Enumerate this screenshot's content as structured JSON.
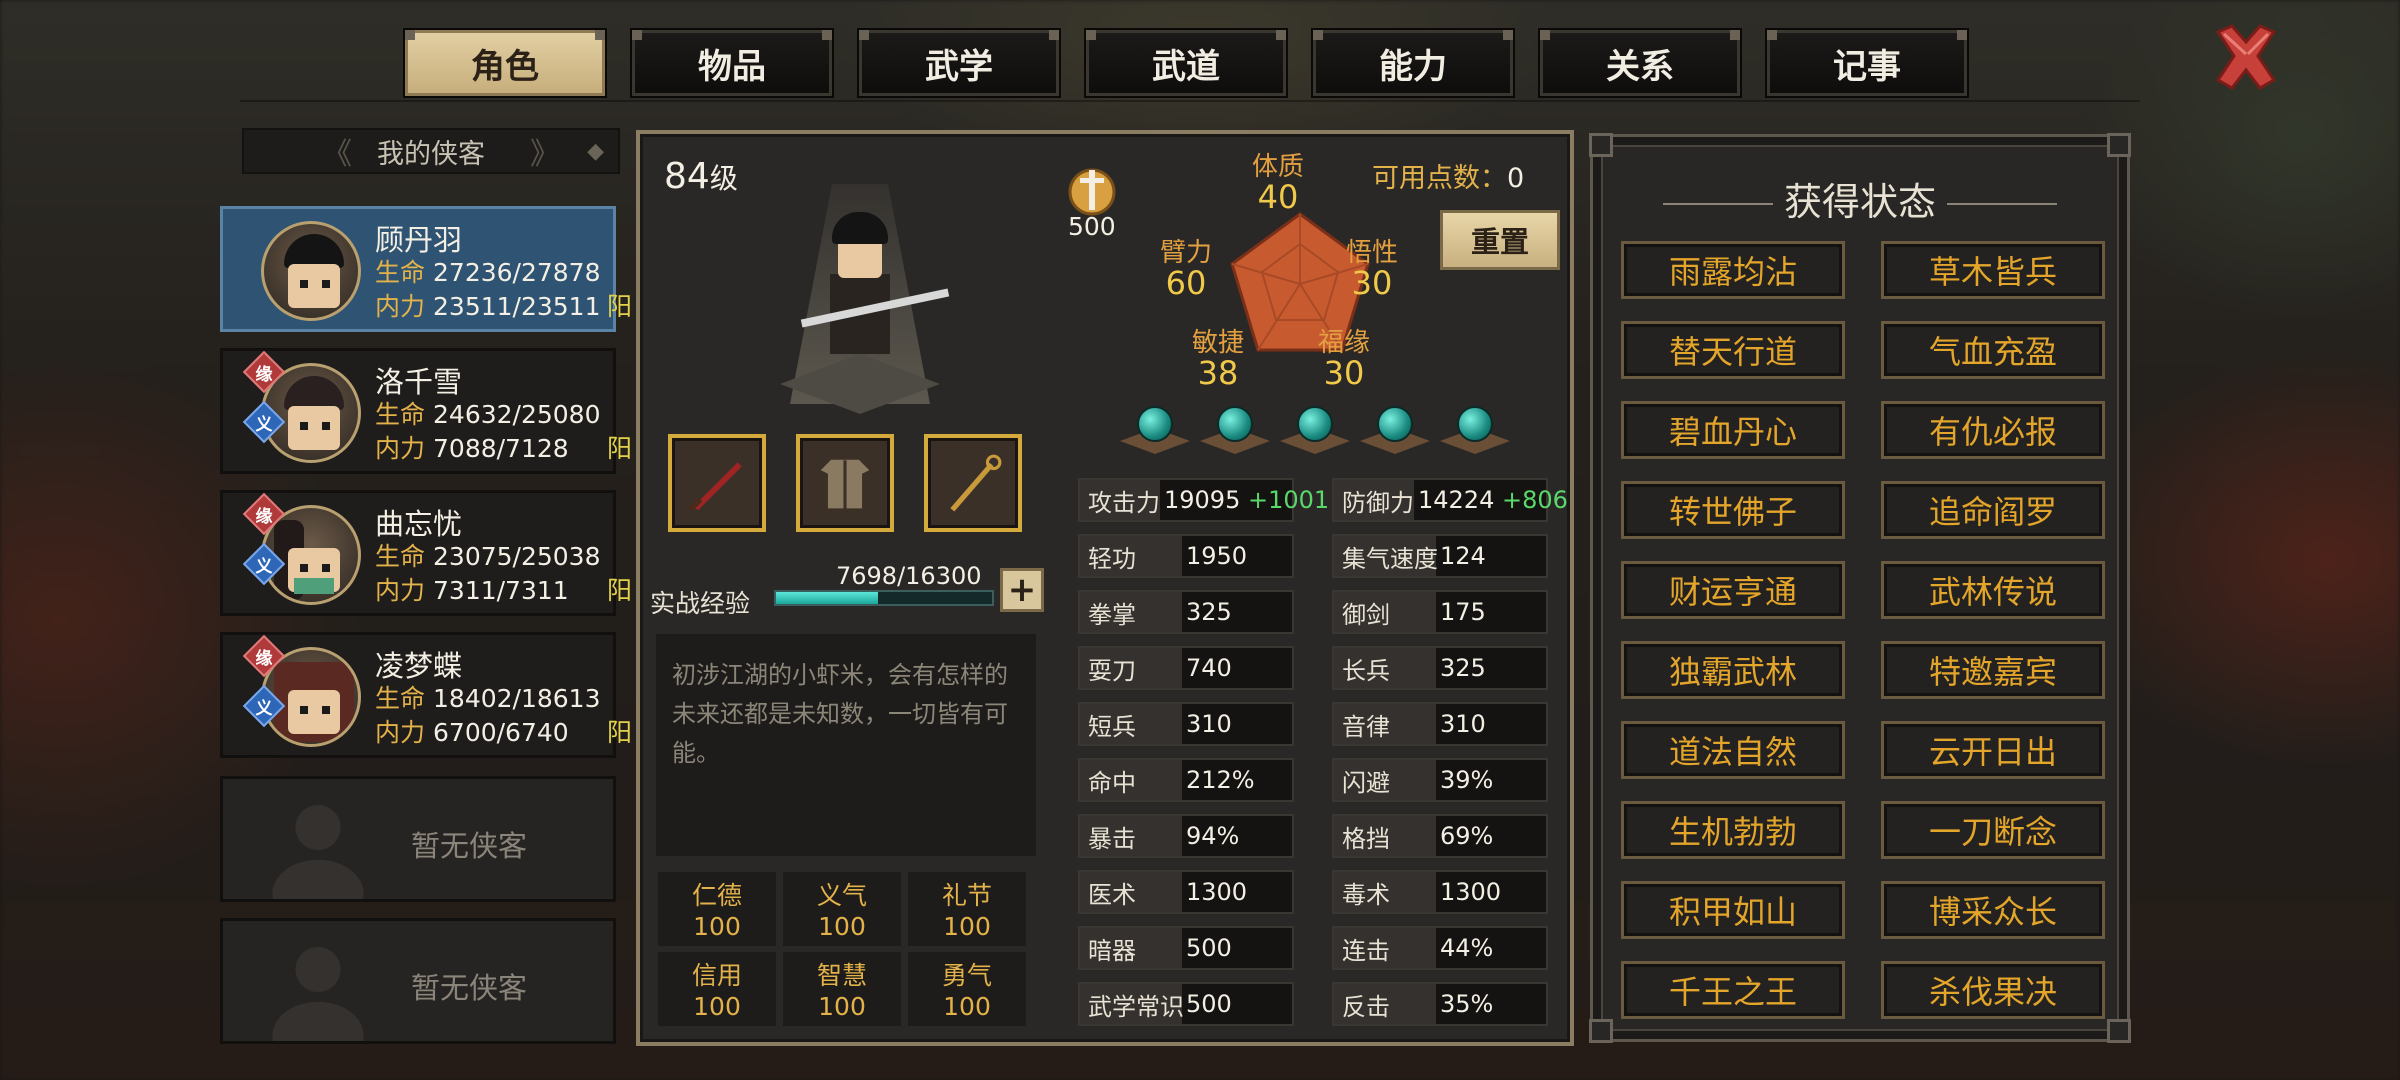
{
  "tabs": [
    "角色",
    "物品",
    "武学",
    "武道",
    "能力",
    "关系",
    "记事"
  ],
  "active_tab": 0,
  "list_header": "我的侠客",
  "characters": [
    {
      "name": "顾丹羽",
      "hp_label": "生命",
      "hp": "27236/27878",
      "mp_label": "内力",
      "mp": "23511/23511",
      "yang": "阳"
    },
    {
      "name": "洛千雪",
      "hp_label": "生命",
      "hp": "24632/25080",
      "mp_label": "内力",
      "mp": "7088/7128",
      "yang": "阳",
      "badge_yuan": "缘",
      "badge_yi": "义"
    },
    {
      "name": "曲忘忧",
      "hp_label": "生命",
      "hp": "23075/25038",
      "mp_label": "内力",
      "mp": "7311/7311",
      "yang": "阳",
      "badge_yuan": "缘",
      "badge_yi": "义"
    },
    {
      "name": "凌梦蝶",
      "hp_label": "生命",
      "hp": "18402/18613",
      "mp_label": "内力",
      "mp": "6700/6740",
      "yang": "阳",
      "badge_yuan": "缘",
      "badge_yi": "义"
    }
  ],
  "empty_slot_label": "暂无侠客",
  "hero": {
    "level_num": "84",
    "level_suffix": "级",
    "coin_value": "500",
    "points_label": "可用点数：",
    "points_value": "0",
    "reset_label": "重置",
    "attributes": {
      "tizhi": {
        "label": "体质",
        "value": "40"
      },
      "bili": {
        "label": "臂力",
        "value": "60"
      },
      "wuxing": {
        "label": "悟性",
        "value": "30"
      },
      "minjie": {
        "label": "敏捷",
        "value": "38"
      },
      "fuyuan": {
        "label": "福缘",
        "value": "30"
      }
    },
    "exp_label": "实战经验",
    "exp_value": "7698/16300",
    "exp_fraction": 0.472,
    "exp_plus": "+",
    "description": "初涉江湖的小虾米，会有怎样的未来还都是未知数，一切皆有可能。",
    "virtues": [
      {
        "name": "仁德",
        "value": "100"
      },
      {
        "name": "义气",
        "value": "100"
      },
      {
        "name": "礼节",
        "value": "100"
      },
      {
        "name": "信用",
        "value": "100"
      },
      {
        "name": "智慧",
        "value": "100"
      },
      {
        "name": "勇气",
        "value": "100"
      }
    ]
  },
  "stats_left": [
    {
      "label": "攻击力",
      "value": "19095",
      "bonus": "+1001"
    },
    {
      "label": "轻功",
      "value": "1950"
    },
    {
      "label": "拳掌",
      "value": "325"
    },
    {
      "label": "耍刀",
      "value": "740"
    },
    {
      "label": "短兵",
      "value": "310"
    },
    {
      "label": "命中",
      "value": "212%"
    },
    {
      "label": "暴击",
      "value": "94%"
    },
    {
      "label": "医术",
      "value": "1300"
    },
    {
      "label": "暗器",
      "value": "500"
    },
    {
      "label": "武学常识",
      "value": "500"
    }
  ],
  "stats_right": [
    {
      "label": "防御力",
      "value": "14224",
      "bonus": "+806"
    },
    {
      "label": "集气速度",
      "value": "124"
    },
    {
      "label": "御剑",
      "value": "175"
    },
    {
      "label": "长兵",
      "value": "325"
    },
    {
      "label": "音律",
      "value": "310"
    },
    {
      "label": "闪避",
      "value": "39%"
    },
    {
      "label": "格挡",
      "value": "69%"
    },
    {
      "label": "毒术",
      "value": "1300"
    },
    {
      "label": "连击",
      "value": "44%"
    },
    {
      "label": "反击",
      "value": "35%"
    }
  ],
  "status_title": "获得状态",
  "statuses": [
    "雨露均沾",
    "草木皆兵",
    "替天行道",
    "气血充盈",
    "碧血丹心",
    "有仇必报",
    "转世佛子",
    "追命阎罗",
    "财运亨通",
    "武林传说",
    "独霸武林",
    "特邀嘉宾",
    "道法自然",
    "云开日出",
    "生机勃勃",
    "一刀断念",
    "积甲如山",
    "博采众长",
    "千王之王",
    "杀伐果决"
  ],
  "colors": {
    "accent_gold": "#e3a52a",
    "selected_card": "#2f5473",
    "exp_teal": "#5ce6d8",
    "bonus_green": "#5ad86a"
  }
}
